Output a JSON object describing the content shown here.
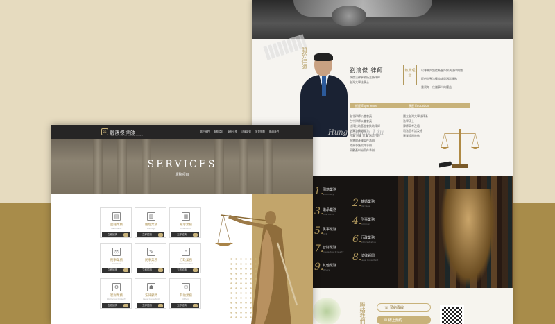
{
  "right_mockup": {
    "profile": {
      "vertical_title": "關於律師",
      "name": "劉鴻傑 律師",
      "lines": [
        "鴻傑法律事務所主持律師",
        "台灣大學法學士"
      ],
      "badge": "執業理念",
      "bullets": [
        "以專業與誠信為客戶解決法律問題",
        "提供完整法律諮詢與訴訟服務",
        "重視每一位當事人的權益"
      ],
      "signature": "Hung Chieh Liu",
      "section_experience": "經歷 Experience",
      "section_education": "學歷 Education",
      "experience_list": [
        "台北律師公會會員",
        "台中律師公會會員",
        "法律扶助基金會扶助律師",
        "企業法律顧問",
        "民事 刑事 家事 訴訟代理",
        "智慧財產權案件承辦",
        "勞資爭議案件承辦",
        "不動產糾紛案件承辦"
      ],
      "education_list": [
        "國立台灣大學法律系",
        "法學碩士",
        "律師高考及格",
        "司法官考試及格",
        "專業證照進修"
      ]
    },
    "services": [
      {
        "num": "1.",
        "label": "國籍業務",
        "en": "Nationality"
      },
      {
        "num": "2.",
        "label": "離婚業務",
        "en": "Marriage"
      },
      {
        "num": "3.",
        "label": "繼承業務",
        "en": "Inheritance"
      },
      {
        "num": "4.",
        "label": "刑事業務",
        "en": "Criminal"
      },
      {
        "num": "5.",
        "label": "民事業務",
        "en": "Civil"
      },
      {
        "num": "6.",
        "label": "行政業務",
        "en": "Administrative"
      },
      {
        "num": "7.",
        "label": "智財業務",
        "en": "Intellectual Property"
      },
      {
        "num": "8.",
        "label": "法律顧問",
        "en": "Legal Consultant"
      },
      {
        "num": "9.",
        "label": "其他業務",
        "en": "Others"
      }
    ],
    "contact": {
      "vertical_title": "聯絡我們",
      "pill1": "預約專線",
      "pill2": "線上預約",
      "qr_label": "QR code"
    }
  },
  "left_mockup": {
    "logo_text": "劉鴻傑律師",
    "logo_sub": "LAW OFFICE OF HUNG-CHIEH",
    "menu": [
      "關於我們",
      "服務項目",
      "案例分享",
      "法律新知",
      "常見問題",
      "聯絡我們"
    ],
    "banner_title": "SERVICES",
    "banner_subtitle": "服務項目",
    "cards": [
      {
        "icon": "▤",
        "label": "國籍業務",
        "en": "Nationality",
        "button": "立即諮詢"
      },
      {
        "icon": "▥",
        "label": "婚姻業務",
        "en": "Marriage",
        "button": "立即諮詢"
      },
      {
        "icon": "▦",
        "label": "繼承業務",
        "en": "Inheritance",
        "button": "立即諮詢"
      },
      {
        "icon": "⚖",
        "label": "刑事業務",
        "en": "Criminal",
        "button": "立即諮詢"
      },
      {
        "icon": "✎",
        "label": "民事業務",
        "en": "Civil",
        "button": "立即諮詢"
      },
      {
        "icon": "⌂",
        "label": "行政業務",
        "en": "Administrative",
        "button": "立即諮詢"
      },
      {
        "icon": "⚙",
        "label": "智財業務",
        "en": "Intellectual Property",
        "button": "立即諮詢"
      },
      {
        "icon": "☗",
        "label": "法律顧問",
        "en": "Legal Consultant",
        "button": "立即諮詢"
      },
      {
        "icon": "✉",
        "label": "其他業務",
        "en": "Others",
        "button": "立即諮詢"
      }
    ]
  }
}
